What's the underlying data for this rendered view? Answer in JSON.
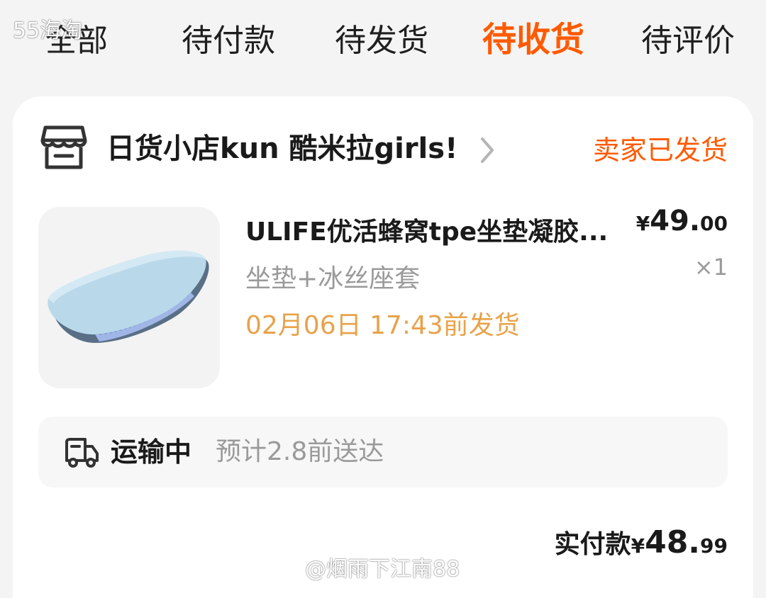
{
  "tabs": [
    {
      "label": "全部",
      "active": false
    },
    {
      "label": "待付款",
      "active": false
    },
    {
      "label": "待发货",
      "active": false
    },
    {
      "label": "待收货",
      "active": true
    },
    {
      "label": "待评价",
      "active": false
    }
  ],
  "watermarks": {
    "top": "55海淘",
    "bottom": "@烟雨下江南88"
  },
  "order": {
    "shop_name": "日货小店kun 酷米拉girls!",
    "status": "卖家已发货",
    "item": {
      "title": "ULIFE优活蜂窝tpe坐垫凝胶...",
      "variant": "坐垫+冰丝座套",
      "ship_deadline": "02月06日 17:43前发货",
      "price_currency": "¥",
      "price_integer": "49.",
      "price_decimal": "00",
      "quantity": "×1"
    },
    "logistics": {
      "status": "运输中",
      "eta": "预计2.8前送达"
    },
    "payment": {
      "label": "实付款",
      "currency": "¥",
      "integer": "48.",
      "decimal": "99"
    }
  },
  "colors": {
    "accent": "#ff5a00",
    "deadline": "#e8a24a",
    "muted": "#9a9a9a",
    "background": "#f4f4f4",
    "card": "#ffffff"
  },
  "icons": {
    "shop": "store-icon",
    "chevron": "chevron-right-icon",
    "truck": "truck-icon"
  }
}
